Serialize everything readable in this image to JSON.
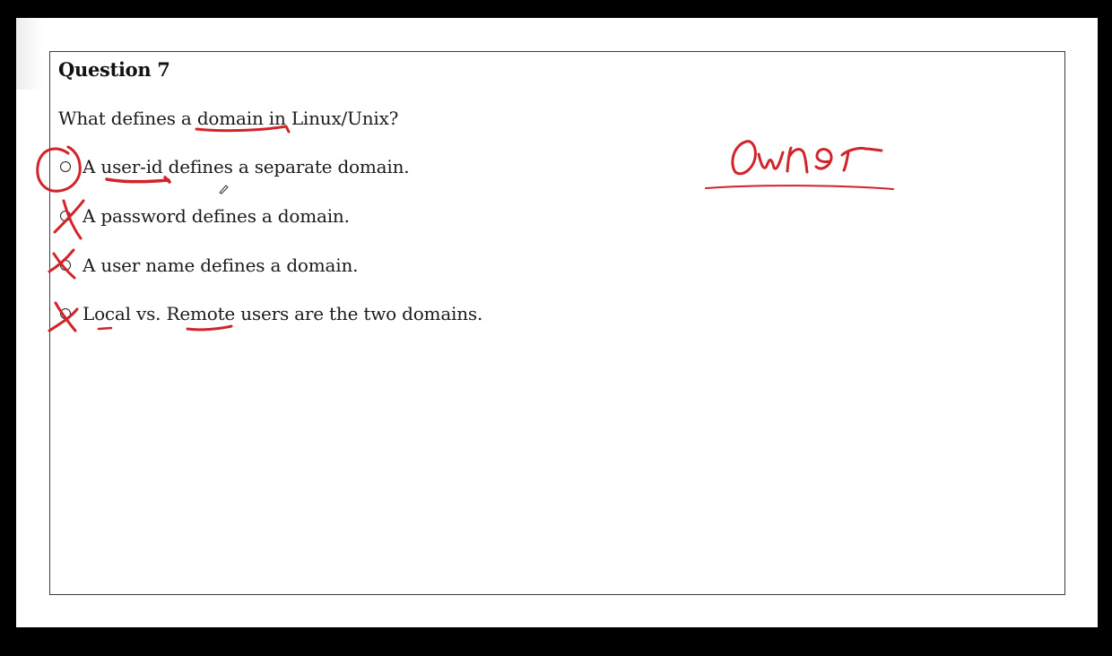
{
  "question": {
    "title": "Question 7",
    "prompt": "What defines a domain in Linux/Unix?"
  },
  "options": [
    {
      "label": "A user-id defines a separate domain."
    },
    {
      "label": "A password defines a domain."
    },
    {
      "label": "A user name defines a domain."
    },
    {
      "label": "Local vs. Remote users are the two domains."
    }
  ],
  "annotation": {
    "handwritten_note": "Owner",
    "ink_color": "#d1232a"
  }
}
